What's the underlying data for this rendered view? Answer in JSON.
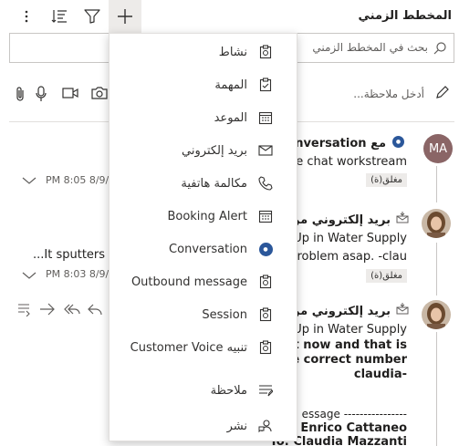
{
  "header": {
    "title": "المخطط الزمني"
  },
  "search": {
    "placeholder": "بحث في المخطط الزمني"
  },
  "note": {
    "placeholder": "أدخل ملاحظة..."
  },
  "timeline": {
    "items": [
      {
        "avatar_initials": "MA",
        "title": "Conversation مع",
        "body": "ve chat workstream",
        "status": "مغلق(ة)",
        "date": "PM 8:05 8/9/"
      },
      {
        "title": "بريد إلكتروني من",
        "body1": "Up in Water Supply",
        "body2": "problem asap. -clau",
        "status": "مغلق(ة)",
        "left_text": "...It sputters a",
        "date": "PM 8:03 8/9/"
      },
      {
        "title": "بريد إلكتروني من",
        "body1": "Up in Water Supply",
        "body2": "ght now and that is",
        "body3": "he correct number",
        "body4": "claudia-",
        "body5": "essage ----------------",
        "body6": "m: Enrico Cattaneo",
        "body7": "To: Claudia Mazzanti"
      }
    ]
  },
  "menu": {
    "items": [
      {
        "label": "نشاط",
        "icon": "activity-icon"
      },
      {
        "label": "المهمة",
        "icon": "task-icon"
      },
      {
        "label": "الموعد",
        "icon": "calendar-icon"
      },
      {
        "label": "بريد إلكتروني",
        "icon": "mail-icon"
      },
      {
        "label": "مكالمة هاتفية",
        "icon": "phone-icon"
      },
      {
        "label": "Booking Alert",
        "icon": "calendar-icon"
      },
      {
        "label": "Conversation",
        "icon": "conversation-icon"
      },
      {
        "label": "Outbound message",
        "icon": "activity-icon"
      },
      {
        "label": "Session",
        "icon": "activity-icon"
      },
      {
        "label": "Customer Voice تنبيه",
        "icon": "activity-icon"
      },
      {
        "label": "ملاحظة",
        "icon": "note-icon"
      },
      {
        "label": "نشر",
        "icon": "post-icon"
      }
    ]
  },
  "colors": {
    "accent": "#2b579a",
    "avatar_bg": "#8a6566",
    "badge_bg": "#edebe9"
  }
}
